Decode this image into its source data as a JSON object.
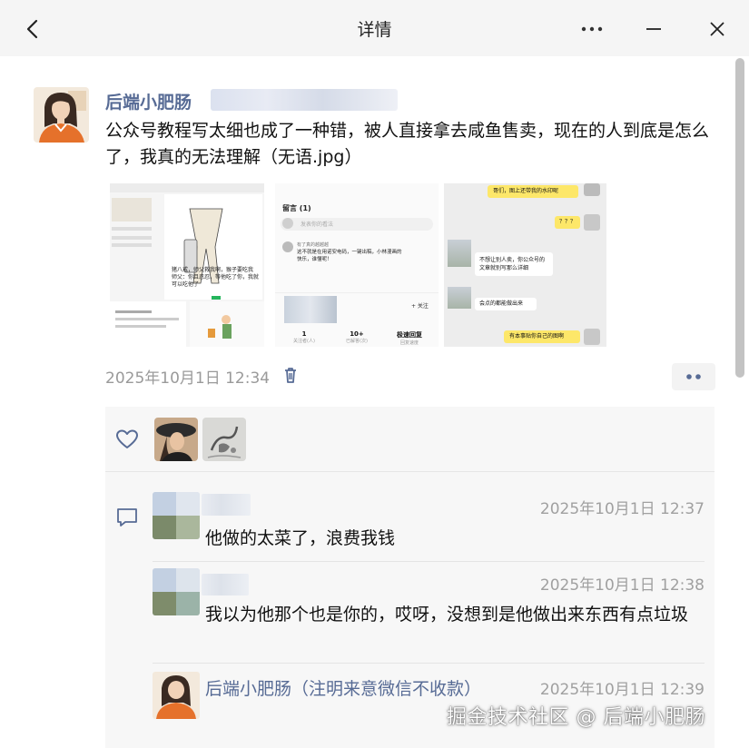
{
  "window": {
    "title": "详情"
  },
  "post": {
    "author": "后端小肥肠",
    "text": "公众号教程写太细也成了一种错，被人直接拿去咸鱼售卖，现在的人到底是怎么了，我真的无法理解（无语.jpg）",
    "timestamp": "2025年10月1日 12:34",
    "images": [
      {
        "caption_lines": [
          "猪八戒，师父救我啊，猴子要吃我",
          "师父：你且忍忍，等他吃了你，我就",
          "可以吃他了"
        ]
      },
      {
        "header": "留言 (1)",
        "input_placeholder": "发表你的看法",
        "comment_name": "有了真的越越越",
        "comment_text": [
          "这不就是在用诺安电码，一键出稿，小林漫画的",
          "快乐，谁懂呢！"
        ],
        "follow_label": "+ 关注",
        "stats": [
          {
            "value": "1",
            "label": "关注者(人)"
          },
          {
            "value": "10+",
            "label": "已解答(次)"
          },
          {
            "value": "极速回复",
            "label": "回复速度"
          }
        ]
      },
      {
        "bubbles": [
          {
            "side": "right",
            "text": "哥们，图上还带我的水印呢"
          },
          {
            "side": "right",
            "text": "？？？"
          },
          {
            "side": "left",
            "text": "不想让别人卖，你公众号的文章就别写那么详细"
          },
          {
            "side": "left",
            "text": "会点的都能做出来"
          },
          {
            "side": "right",
            "text": "有本事贴你自己的图啊"
          }
        ]
      }
    ]
  },
  "comments": [
    {
      "time": "2025年10月1日 12:37",
      "text": "他做的太菜了，浪费我钱"
    },
    {
      "time": "2025年10月1日 12:38",
      "text": "我以为他那个也是你的，哎呀，没想到是他做出来东西有点垃圾"
    },
    {
      "name": "后端小肥肠（注明来意微信不收款）",
      "time": "2025年10月1日 12:39"
    }
  ],
  "watermark": "掘金技术社区 @ 后端小肥肠",
  "icons": {
    "back": "chevron-left-icon",
    "more": "ellipsis-icon",
    "minimize": "minimize-icon",
    "close": "close-icon",
    "trash": "trash-icon",
    "like": "heart-icon",
    "comment": "comment-icon"
  },
  "colors": {
    "link": "#576b95",
    "timestamp": "#9a9a9a",
    "panel": "#f7f7f7",
    "wechat_green": "#95ec69",
    "chat_yellow": "#fde769"
  }
}
